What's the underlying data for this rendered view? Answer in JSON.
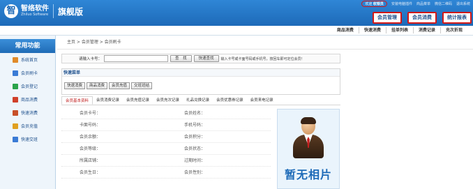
{
  "brand": {
    "name": "智络软件",
    "en": "Zhiluo Software",
    "edition": "旗舰版"
  },
  "topbar": {
    "welcome": "欢迎",
    "user": "收银员",
    "links": [
      "安装电脑插件",
      "商品菜单",
      "微信二维码",
      "退出系统"
    ]
  },
  "mainnav": [
    "会员管理",
    "会员消费",
    "统计报表"
  ],
  "subtoolbar": [
    "商品消费",
    "快速消费",
    "挂单列表",
    "消费记录",
    "充次折现"
  ],
  "sidebar": {
    "title": "常用功能",
    "items": [
      {
        "label": "系统首页",
        "color": "#e08a2a"
      },
      {
        "label": "会员刷卡",
        "color": "#3a7bd5"
      },
      {
        "label": "会员登记",
        "color": "#2aa34a"
      },
      {
        "label": "商品消费",
        "color": "#d0402a"
      },
      {
        "label": "快速消费",
        "color": "#c8502a"
      },
      {
        "label": "会员充值",
        "color": "#e0a020"
      },
      {
        "label": "快速交班",
        "color": "#3a7bd5"
      }
    ]
  },
  "breadcrumb": "主页 > 会员管理 > 会员刷卡",
  "search": {
    "label": "请输入卡号：",
    "placeholder": "",
    "btn_search": "查　找",
    "btn_quick": "快速查找",
    "hint": "输入卡号或卡面号码或手机号，按回车即可定位会员！"
  },
  "quickmenu": {
    "title": "快速菜单",
    "buttons": [
      "快速消费",
      "商品消费",
      "会员充值",
      "交班班结"
    ]
  },
  "tabs": [
    "会员基本资料",
    "会员消费记录",
    "会员充值记录",
    "会员充次记录",
    "礼品兑换记录",
    "会员优惠券记录",
    "会员来电记录"
  ],
  "info": {
    "rows": [
      [
        "会员卡号：",
        "会员姓名："
      ],
      [
        "卡面号码：",
        "手机号码："
      ],
      [
        "会员余额：",
        "会员积分："
      ],
      [
        "会员等级：",
        "会员状态："
      ],
      [
        "所属店铺：",
        "过期时间："
      ],
      [
        "会员生日：",
        "会员性别："
      ]
    ]
  },
  "photo": {
    "label": "暂无相片"
  }
}
